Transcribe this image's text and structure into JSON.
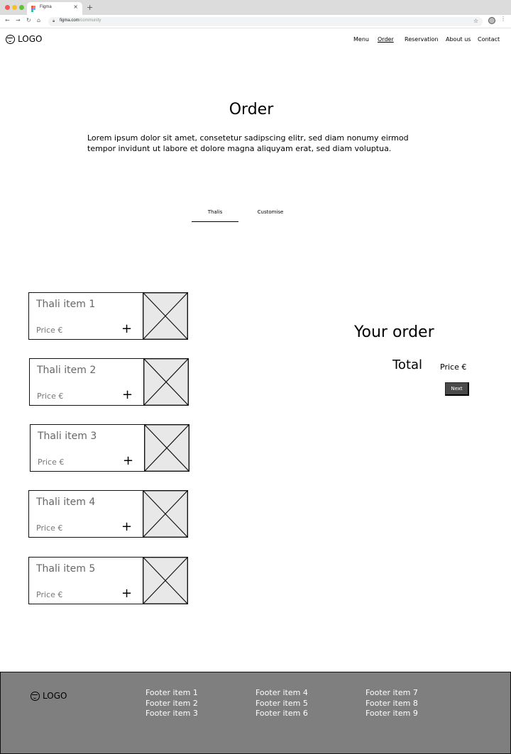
{
  "browser": {
    "tab_title": "Figma",
    "close_glyph": "×",
    "new_tab_glyph": "+",
    "url_host": "figma.com",
    "url_path": "/community"
  },
  "header": {
    "logo_text": "LOGO",
    "nav": [
      "Menu",
      "Order",
      "Reservation",
      "About us",
      "Contact"
    ],
    "active_nav": "Order"
  },
  "hero": {
    "title": "Order",
    "intro": "Lorem ipsum dolor sit amet, consetetur sadipscing elitr, sed diam nonumy eirmod tempor invidunt ut labore et dolore magna aliquyam erat, sed diam voluptua."
  },
  "tabs": {
    "thalis": "Thalis",
    "customise": "Customise",
    "active": "Thalis"
  },
  "items": [
    {
      "name": "Thali item 1",
      "price": "Price €",
      "add": "+"
    },
    {
      "name": "Thali item 2",
      "price": "Price €",
      "add": "+"
    },
    {
      "name": "Thali item 3",
      "price": "Price €",
      "add": "+"
    },
    {
      "name": "Thali item 4",
      "price": "Price €",
      "add": "+"
    },
    {
      "name": "Thali item 5",
      "price": "Price €",
      "add": "+"
    }
  ],
  "summary": {
    "title": "Your order",
    "total_label": "Total",
    "total_price": "Price €",
    "next_label": "Next"
  },
  "footer": {
    "logo_text": "LOGO",
    "col1": [
      "Footer item 1",
      "Footer item 2",
      "Footer item 3"
    ],
    "col2": [
      "Footer item 4",
      "Footer item 5",
      "Footer item 6"
    ],
    "col3": [
      "Footer item 7",
      "Footer item 8",
      "Footer item 9"
    ]
  },
  "colors": {
    "footer_bg": "#7f7f7f",
    "button_bg": "#4a4a4a",
    "placeholder_fill": "#e8e8e8"
  }
}
